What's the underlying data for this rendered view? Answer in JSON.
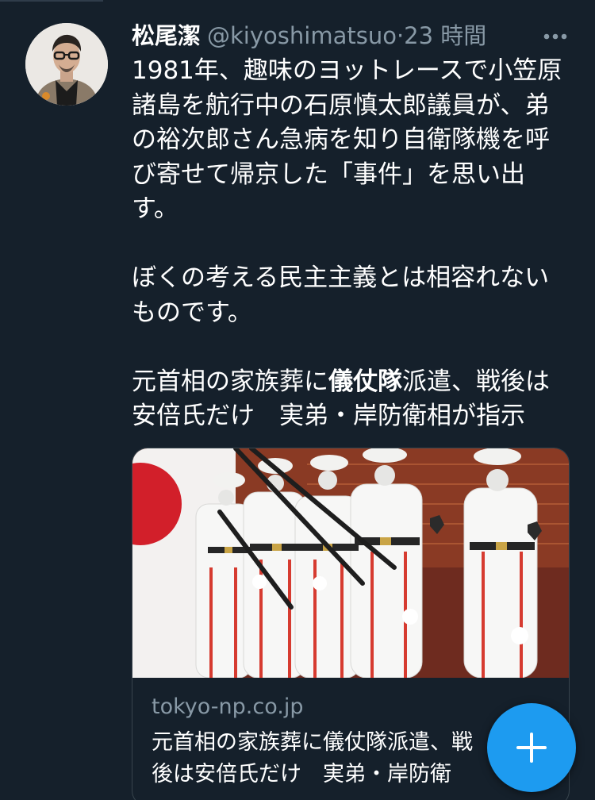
{
  "tweet": {
    "author": {
      "display_name": "松尾潔",
      "handle": "@kiyoshimatsuo",
      "separator": "·",
      "time_ago": "23 時間"
    },
    "paragraphs": [
      "1981年、趣味のヨットレースで小笠原\n諸島を航行中の石原慎太郎議員が、弟\nの裕次郎さん急病を知り自衛隊機を呼\nび寄せて帰京した「事件」を思い出\nす。",
      "ぼくの考える民主主義とは相容れない\nものです。"
    ],
    "headline": {
      "before": "元首相の家族葬に",
      "bold": "儀仗隊",
      "after": "派遣、戦後は\n安倍氏だけ　実弟・岸防衛相が指示"
    },
    "card": {
      "domain": "tokyo-np.co.jp",
      "title": "元首相の家族葬に儀仗隊派遣、戦\n後は安倍氏だけ　実弟・岸防衛"
    },
    "icons": {
      "more": "more-horizontal-icon",
      "compose": "plus-icon"
    }
  },
  "colors": {
    "background": "#15202b",
    "secondary_text": "#8899a6",
    "accent": "#1d9bf0"
  }
}
